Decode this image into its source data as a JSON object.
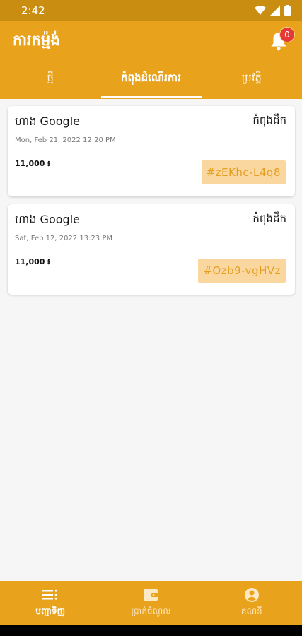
{
  "status_bar": {
    "time": "2:42"
  },
  "appbar": {
    "title": "ការកម្ម៉ង់",
    "notification_count": "0"
  },
  "tabs": [
    {
      "label": "ថ្មី"
    },
    {
      "label": "កំពុងដំណើរការ"
    },
    {
      "label": "ប្រវត្តិ"
    }
  ],
  "orders": [
    {
      "shop": "ហាង Google",
      "status": "កំពុងដឹក",
      "date": "Mon, Feb 21, 2022 12:20 PM",
      "amount": "11,000 ៛",
      "code": "#zEKhc-L4q8"
    },
    {
      "shop": "ហាង Google",
      "status": "កំពុងដឹក",
      "date": "Sat, Feb 12, 2022 13:23 PM",
      "amount": "11,000 ៛",
      "code": "#Ozb9-vgHVz"
    }
  ],
  "bottom_nav": [
    {
      "label": "បញ្ជាទិញ",
      "icon": "list-icon"
    },
    {
      "label": "ប្រាក់ចំណូល",
      "icon": "wallet-icon"
    },
    {
      "label": "គណនី",
      "icon": "account-icon"
    }
  ],
  "colors": {
    "primary": "#e9a21c",
    "status_bar": "#c98d12",
    "code_bg": "#fbd7a0",
    "badge": "#e53935"
  }
}
